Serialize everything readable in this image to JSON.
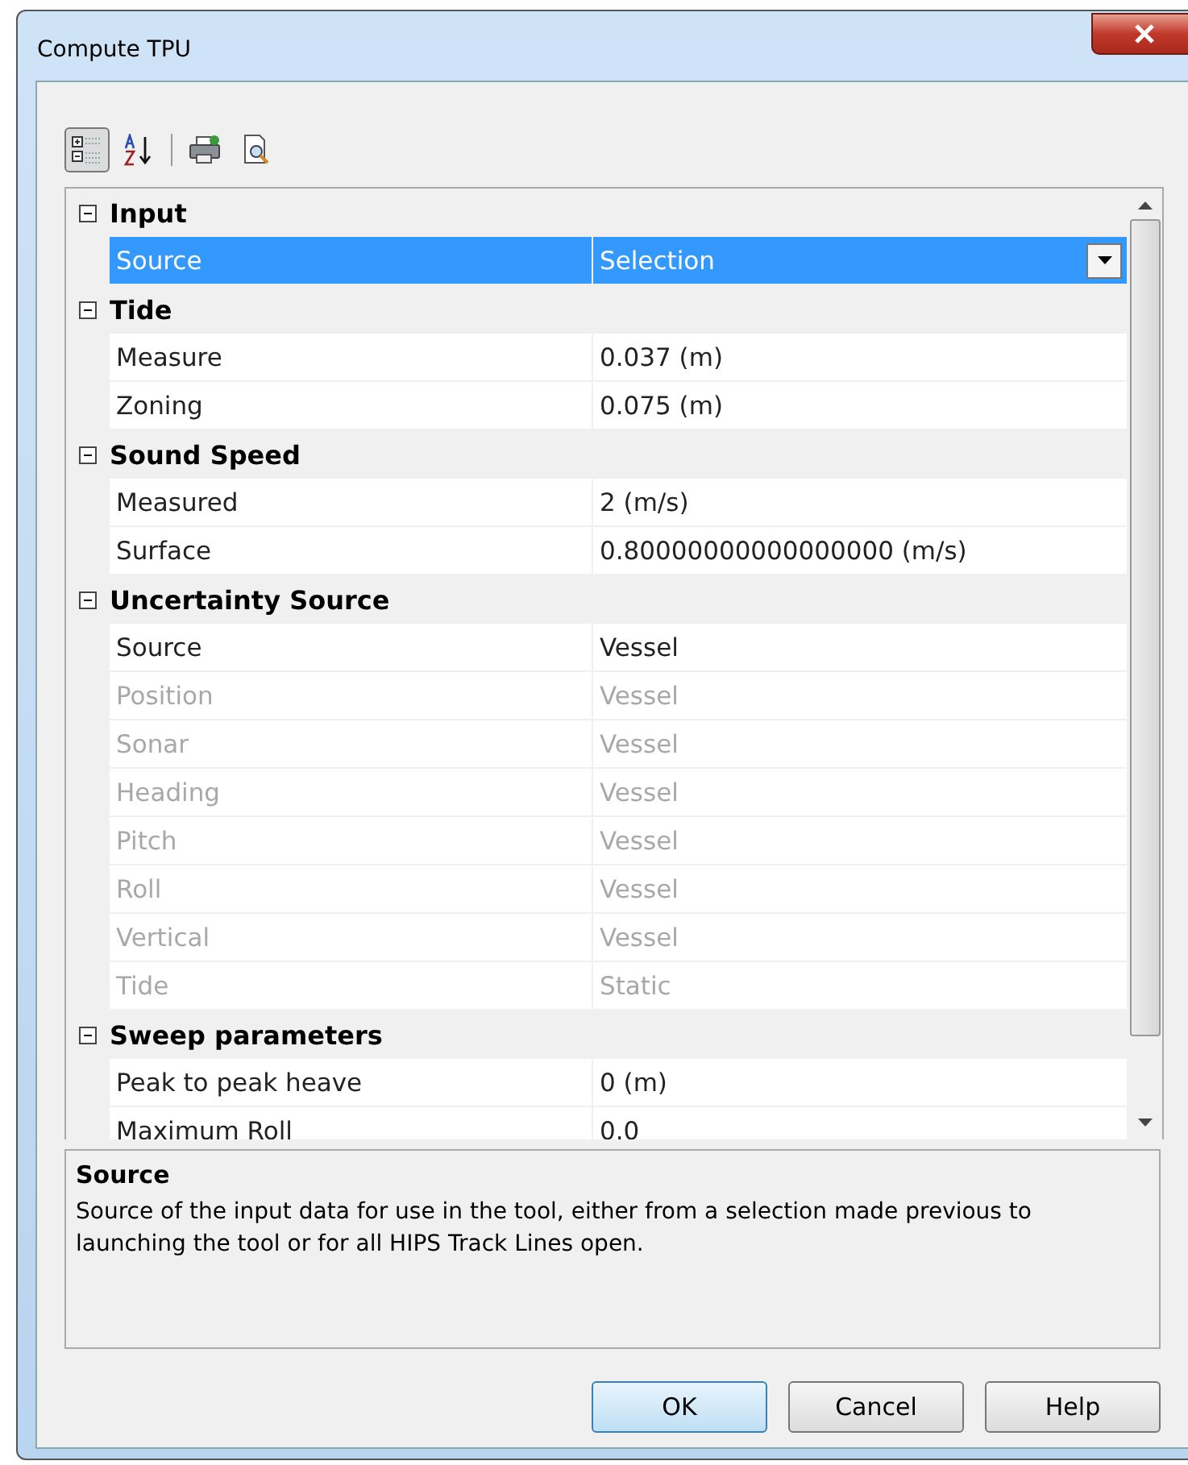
{
  "window": {
    "title": "Compute TPU"
  },
  "toolbar": [
    {
      "kind": "categorized",
      "selected": true
    },
    {
      "kind": "alphabetical",
      "selected": false
    },
    {
      "kind": "separator"
    },
    {
      "kind": "print",
      "selected": false
    },
    {
      "kind": "preview",
      "selected": false
    }
  ],
  "grid": {
    "categories": [
      {
        "name": "Input",
        "expanded": true,
        "properties": [
          {
            "name": "Source",
            "value": "Selection",
            "selected": true,
            "disabled": false,
            "dropdown": true
          }
        ]
      },
      {
        "name": "Tide",
        "expanded": true,
        "properties": [
          {
            "name": "Measure",
            "value": "0.037 (m)",
            "selected": false,
            "disabled": false,
            "dropdown": false
          },
          {
            "name": "Zoning",
            "value": "0.075 (m)",
            "selected": false,
            "disabled": false,
            "dropdown": false
          }
        ]
      },
      {
        "name": "Sound Speed",
        "expanded": true,
        "properties": [
          {
            "name": "Measured",
            "value": "2 (m/s)",
            "selected": false,
            "disabled": false,
            "dropdown": false
          },
          {
            "name": "Surface",
            "value": "0.80000000000000000 (m/s)",
            "selected": false,
            "disabled": false,
            "dropdown": false
          }
        ]
      },
      {
        "name": "Uncertainty Source",
        "expanded": true,
        "properties": [
          {
            "name": "Source",
            "value": "Vessel",
            "selected": false,
            "disabled": false,
            "dropdown": false
          },
          {
            "name": "Position",
            "value": "Vessel",
            "selected": false,
            "disabled": true,
            "dropdown": false
          },
          {
            "name": "Sonar",
            "value": "Vessel",
            "selected": false,
            "disabled": true,
            "dropdown": false
          },
          {
            "name": "Heading",
            "value": "Vessel",
            "selected": false,
            "disabled": true,
            "dropdown": false
          },
          {
            "name": "Pitch",
            "value": "Vessel",
            "selected": false,
            "disabled": true,
            "dropdown": false
          },
          {
            "name": "Roll",
            "value": "Vessel",
            "selected": false,
            "disabled": true,
            "dropdown": false
          },
          {
            "name": "Vertical",
            "value": "Vessel",
            "selected": false,
            "disabled": true,
            "dropdown": false
          },
          {
            "name": "Tide",
            "value": "Static",
            "selected": false,
            "disabled": true,
            "dropdown": false
          }
        ]
      },
      {
        "name": "Sweep parameters",
        "expanded": true,
        "properties": [
          {
            "name": "Peak to peak heave",
            "value": "0 (m)",
            "selected": false,
            "disabled": false,
            "dropdown": false
          },
          {
            "name": "Maximum Roll",
            "value": "0.0",
            "selected": false,
            "disabled": false,
            "dropdown": false
          }
        ]
      }
    ]
  },
  "description": {
    "title": "Source",
    "text": "Source of the input data for use in the tool, either from a selection made previous to launching the tool or for all HIPS Track Lines open."
  },
  "buttons": [
    {
      "label": "OK",
      "default": true
    },
    {
      "label": "Cancel",
      "default": false
    },
    {
      "label": "Help",
      "default": false
    }
  ]
}
